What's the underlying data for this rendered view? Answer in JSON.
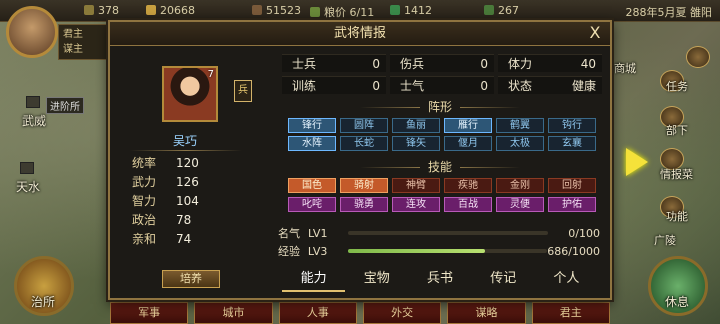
{
  "topbar": {
    "resources": [
      {
        "icon": "food-icon",
        "value": "378"
      },
      {
        "icon": "gold-icon",
        "value": "20668"
      },
      {
        "icon": "troops-icon",
        "value": "51523"
      },
      {
        "icon": "grain-icon",
        "label": "粮价",
        "value": "6/11"
      },
      {
        "icon": "money-icon",
        "value": "1412"
      },
      {
        "icon": "order-icon",
        "value": "267"
      }
    ],
    "date": "288年5月夏 雒阳"
  },
  "lord": {
    "line1": "君主",
    "line2": "谋主"
  },
  "map": {
    "cities": [
      "武威",
      "天水"
    ],
    "advance_tag": "进阶所",
    "right_menu": [
      "商城",
      "任务",
      "部下",
      "情报菜",
      "功能",
      "广陵"
    ],
    "left_button": "治所",
    "right_button": "休息"
  },
  "bottombar": [
    "军事",
    "城市",
    "人事",
    "外交",
    "谋略",
    "君主"
  ],
  "dialog": {
    "title": "武将情报",
    "close": "X",
    "general": {
      "name": "吴巧",
      "level": "7",
      "type_badge": "兵",
      "stats": [
        {
          "label": "统率",
          "value": "120"
        },
        {
          "label": "武力",
          "value": "126"
        },
        {
          "label": "智力",
          "value": "104"
        },
        {
          "label": "政治",
          "value": "78"
        },
        {
          "label": "亲和",
          "value": "74"
        }
      ],
      "train_button": "培养"
    },
    "table": [
      [
        {
          "k": "士兵",
          "v": "0"
        },
        {
          "k": "伤兵",
          "v": "0"
        },
        {
          "k": "体力",
          "v": "40"
        }
      ],
      [
        {
          "k": "训练",
          "v": "0"
        },
        {
          "k": "士气",
          "v": "0"
        },
        {
          "k": "状态",
          "v": "健康"
        }
      ]
    ],
    "formation_title": "阵形",
    "formations": [
      {
        "label": "锋行",
        "active": true
      },
      {
        "label": "圆阵",
        "active": false
      },
      {
        "label": "鱼丽",
        "active": false
      },
      {
        "label": "雁行",
        "active": true
      },
      {
        "label": "鹤翼",
        "active": false
      },
      {
        "label": "钩行",
        "active": false
      },
      {
        "label": "水阵",
        "active": true
      },
      {
        "label": "长蛇",
        "active": false
      },
      {
        "label": "锋矢",
        "active": false
      },
      {
        "label": "偃月",
        "active": false
      },
      {
        "label": "太极",
        "active": false
      },
      {
        "label": "玄襄",
        "active": false
      }
    ],
    "skill_title": "技能",
    "skills": [
      {
        "label": "国色",
        "style": "hot"
      },
      {
        "label": "骑射",
        "style": "hot"
      },
      {
        "label": "神臂",
        "style": "red"
      },
      {
        "label": "疾驰",
        "style": "red"
      },
      {
        "label": "金刚",
        "style": "red"
      },
      {
        "label": "回射",
        "style": "red"
      },
      {
        "label": "叱咤",
        "style": "pur"
      },
      {
        "label": "骁勇",
        "style": "pur"
      },
      {
        "label": "连攻",
        "style": "pur"
      },
      {
        "label": "百战",
        "style": "pur"
      },
      {
        "label": "灵便",
        "style": "pur"
      },
      {
        "label": "护佑",
        "style": "pur"
      }
    ],
    "fame": {
      "label": "名气",
      "level": "LV1",
      "progress": "0/100",
      "ratio": 0
    },
    "exp": {
      "label": "经验",
      "level": "LV3",
      "progress": "686/1000",
      "ratio": 0.686
    },
    "tabs": [
      "能力",
      "宝物",
      "兵书",
      "传记",
      "个人"
    ],
    "active_tab": 0
  }
}
